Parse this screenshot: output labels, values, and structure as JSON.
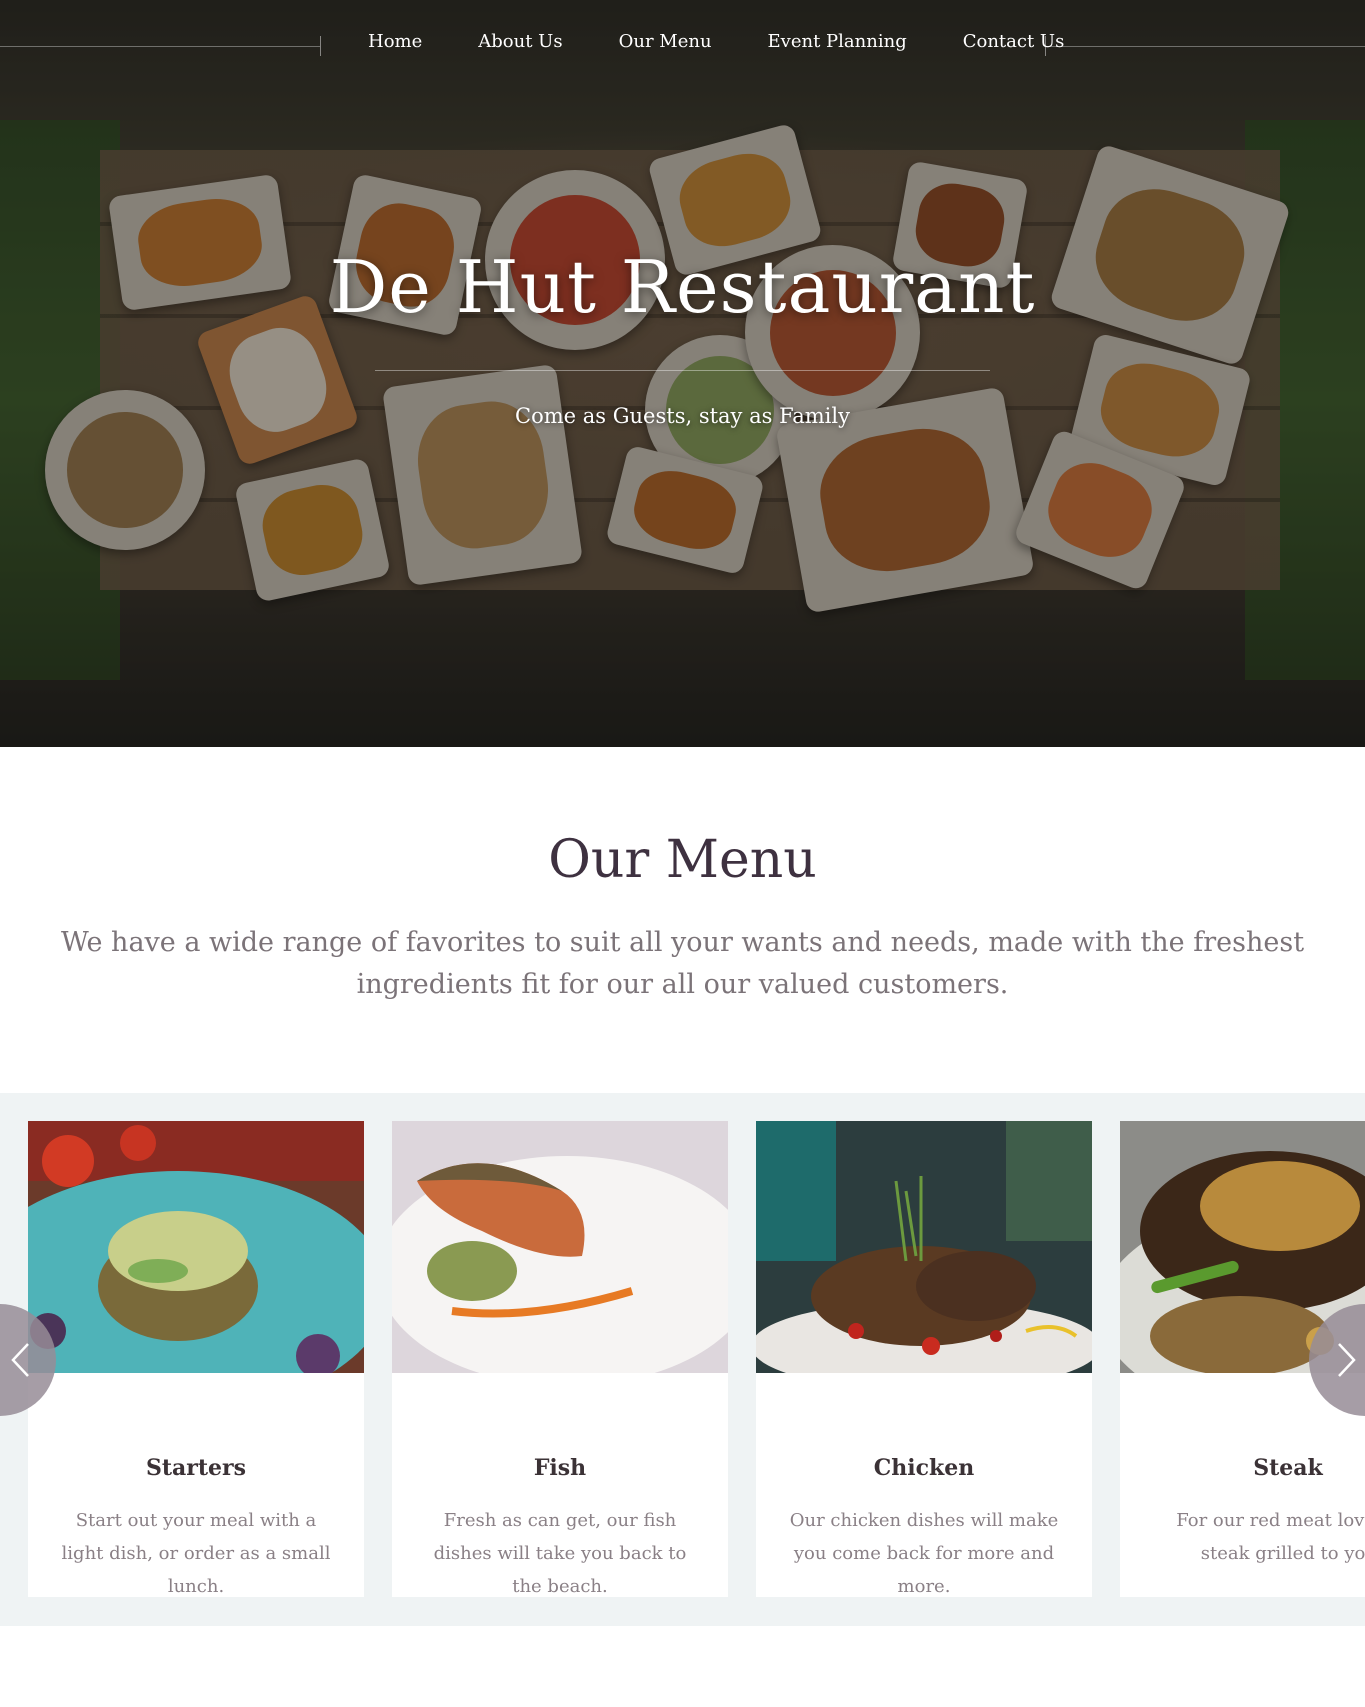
{
  "nav": {
    "items": [
      {
        "label": "Home"
      },
      {
        "label": "About Us"
      },
      {
        "label": "Our Menu"
      },
      {
        "label": "Event Planning"
      },
      {
        "label": "Contact Us"
      }
    ]
  },
  "hero": {
    "title": "De Hut Restaurant",
    "tagline": "Come as Guests, stay as Family"
  },
  "menu": {
    "title": "Our Menu",
    "description": "We have a wide range of favorites to suit all your wants and needs, made with the freshest ingredients fit for our all our valued customers."
  },
  "carousel": {
    "cards": [
      {
        "title": "Starters",
        "text": "Start out your meal with a light dish, or order as a small lunch."
      },
      {
        "title": "Fish",
        "text": "Fresh as can get, our fish dishes will take you back to the beach."
      },
      {
        "title": "Chicken",
        "text": "Our chicken dishes will make you come back for more and more."
      },
      {
        "title": "Steak",
        "text": "For our red meat lovers, the steak grilled to your ta"
      }
    ],
    "prev_icon": "chevron-left-icon",
    "next_icon": "chevron-right-icon"
  },
  "colors": {
    "heading": "#3e3140",
    "body_text": "#7b7378",
    "carousel_bg": "#eff3f4",
    "arrow_bg": "#968c96"
  }
}
